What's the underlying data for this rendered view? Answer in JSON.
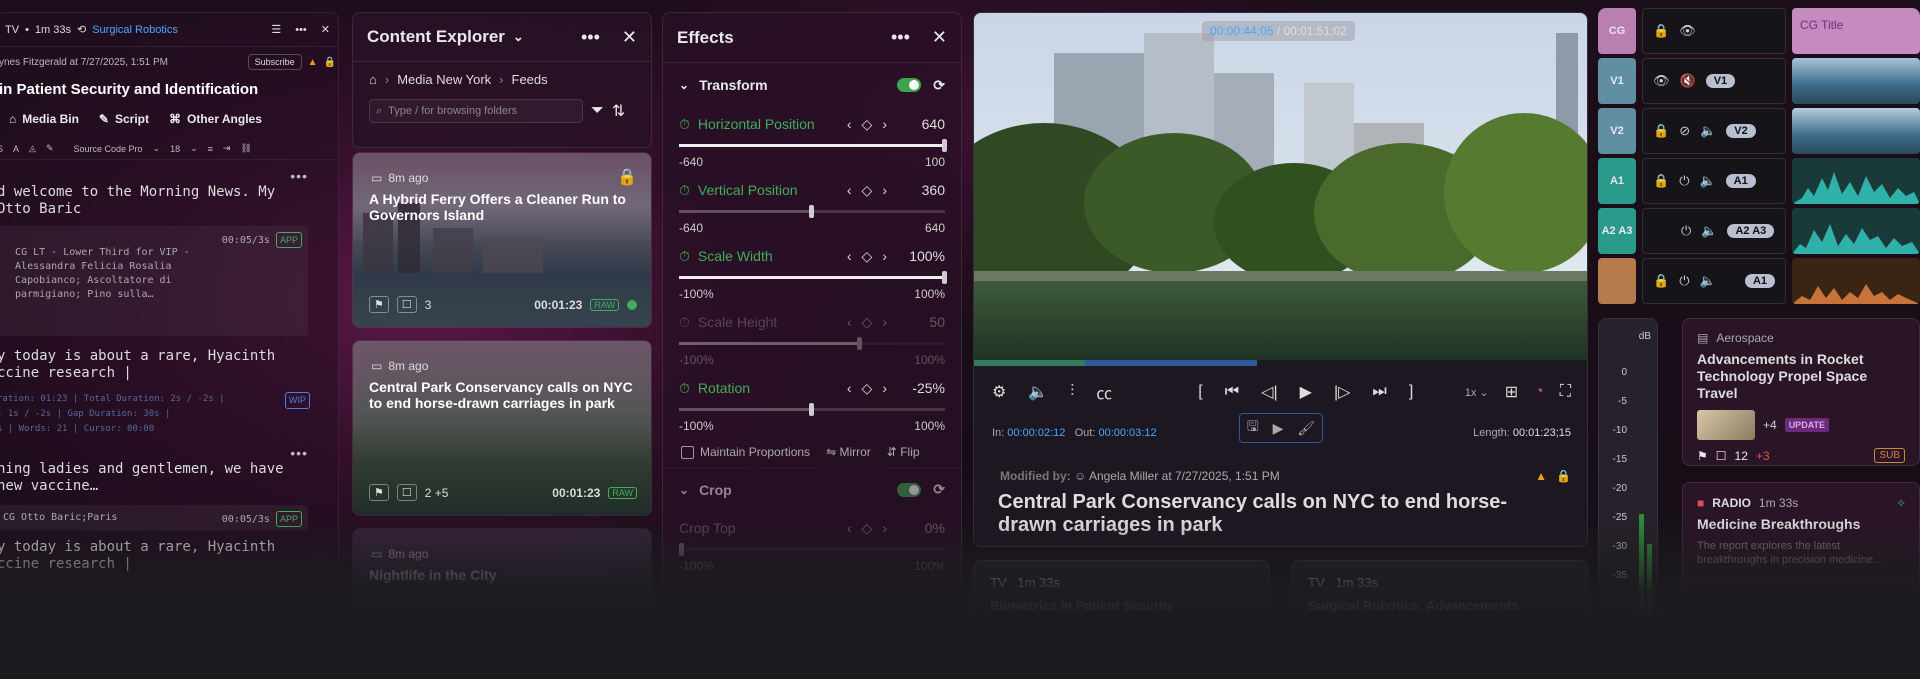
{
  "left_panel": {
    "top_label": "TV",
    "top_duration": "1m 33s",
    "top_tag": "Surgical Robotics",
    "meta": "ynes Fitzgerald at 7/27/2025, 1:51 PM",
    "subscribe": "Subscribe",
    "title": "in Patient Security and Identification",
    "tabs": [
      "Media Bin",
      "Script",
      "Other Angles"
    ],
    "font_name": "Source Code Pro",
    "font_size": "18",
    "text1": "d welcome to the Morning News. My\nOtto Baric",
    "cg1_time": "00:05/3s",
    "cg1_badge": "APP",
    "cg1_text": "CG LT - Lower Third for VIP -\n  Alessandra Felicia Rosalia\n  Capobianco; Ascoltatore di\n  parmigiano; Pino sulla…",
    "text2": "y today is about a rare, Hyacinth\nccine research |",
    "stats": "ration: 01:23 | Total Duration: 2s / -2s |\n: 1s / -2s | Gap Duration: 30s |\ns | Words: 21 | Cursor: 00:00",
    "stats_badge": "WIP",
    "text3": "ning ladies and gentlemen, we have\nnew vaccine…",
    "cg2_text": "CG Otto Baric;Paris",
    "cg2_time": "00:05/3s",
    "cg2_badge": "APP",
    "text4": "y today is about a rare, Hyacinth\nccine research |"
  },
  "content_explorer": {
    "title": "Content Explorer",
    "breadcrumb": [
      "Media New York",
      "Feeds"
    ],
    "search_placeholder": "Type / for browsing folders",
    "cards": [
      {
        "age": "8m ago",
        "title": "A Hybrid Ferry Offers a Cleaner Run to Governors Island",
        "comments": "3",
        "duration": "00:01:23",
        "badge": "RAW"
      },
      {
        "age": "8m ago",
        "title": "Central Park Conservancy calls on NYC to end horse-drawn carriages in park",
        "comments": "2 +5",
        "duration": "00:01:23",
        "badge": "RAW"
      },
      {
        "age": "8m ago",
        "title": "Nightlife in the City"
      }
    ]
  },
  "effects": {
    "title": "Effects",
    "section": "Transform",
    "params": [
      {
        "name": "Horizontal Position",
        "value": "640",
        "min": "-640",
        "max": "100",
        "fill": 1.0
      },
      {
        "name": "Vertical Position",
        "value": "360",
        "min": "-640",
        "max": "640",
        "fill": 0.5
      },
      {
        "name": "Scale Width",
        "value": "100%",
        "min": "-100%",
        "max": "100%",
        "fill": 1.0
      },
      {
        "name": "Scale Height",
        "value": "50",
        "min": "-100%",
        "max": "100%",
        "fill": 0.68
      },
      {
        "name": "Rotation",
        "value": "-25%",
        "min": "-100%",
        "max": "100%",
        "fill": 0.5
      }
    ],
    "maintain": "Maintain Proportions",
    "mirror": "Mirror",
    "flip": "Flip",
    "crop_section": "Crop",
    "crop_param": {
      "name": "Crop Top",
      "value": "0%",
      "min": "-100%",
      "max": "100%"
    }
  },
  "viewer": {
    "timecode_current": "00:00:44;05",
    "timecode_total": "00:01:51;02",
    "progress_played": 0.18,
    "progress_buffered": 0.46,
    "speed": "1x",
    "in_label": "In:",
    "in_value": "00:00:02:12",
    "out_label": "Out:",
    "out_value": "00:00:03:12",
    "length_label": "Length:",
    "length_value": "00:01:23;15",
    "modified_label": "Modified by:",
    "modified_value": "Angela Miller at 7/27/2025, 1:51 PM",
    "title": "Central Park Conservancy calls on NYC to end horse-drawn carriages in park"
  },
  "sub_cards": [
    {
      "label": "TV",
      "duration": "1m 33s",
      "title": "Biometrics in Patient Security"
    },
    {
      "label": "TV",
      "duration": "1m 33s",
      "title": "Surgical Robotics: Advancements"
    }
  ],
  "tracks": [
    {
      "label": "CG",
      "pill": "",
      "clip": "CG Title",
      "color": "#b87fb0"
    },
    {
      "label": "V1",
      "pill": "V1",
      "color": "#5f8fa0"
    },
    {
      "label": "V2",
      "pill": "V2",
      "color": "#5f8fa0"
    },
    {
      "label": "A1",
      "pill": "A1",
      "color": "#2a9a8a"
    },
    {
      "label": "A2 A3",
      "pill": "A2 A3",
      "color": "#2a9a8a"
    },
    {
      "label": "",
      "pill": "A1",
      "color": "#b77a4a"
    }
  ],
  "meter": {
    "unit": "dB",
    "ticks": [
      "0",
      "-5",
      "-10",
      "-15",
      "-20",
      "-25",
      "-30",
      "-35"
    ]
  },
  "articles": [
    {
      "category": "Aerospace",
      "title": "Advancements in Rocket Technology Propel Space Travel",
      "more": "+4",
      "badge": "UPDATE",
      "comments": "12",
      "comments_extra": "+3",
      "side": "SUB"
    },
    {
      "category": "RADIO",
      "duration": "1m 33s",
      "title": "Medicine Breakthroughs",
      "body": "The report explores the latest breakthroughs in precision medicine…"
    }
  ]
}
